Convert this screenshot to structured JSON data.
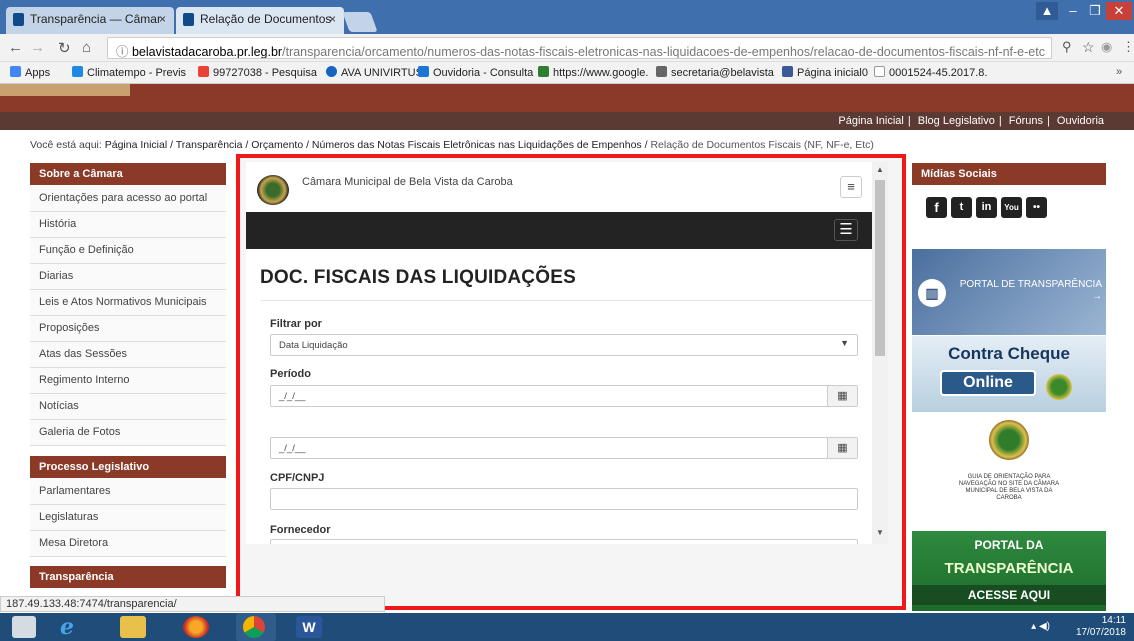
{
  "browser": {
    "tabs": [
      {
        "label": "Transparência — Câmar",
        "close": "×"
      },
      {
        "label": "Relação de Documentos",
        "close": "×"
      }
    ],
    "url_host": "belavistadacaroba.pr.leg.br",
    "url_path": "/transparencia/orcamento/numeros-das-notas-fiscais-eletronicas-nas-liquidacoes-de-empenhos/relacao-de-documentos-fiscais-nf-nf-e-etc",
    "bookmarks": [
      {
        "label": "Apps",
        "color": "#4285f4"
      },
      {
        "label": "Climatempo - Previs",
        "color": "#1e88e5"
      },
      {
        "label": "99727038 - Pesquisa",
        "color": "#ea4335"
      },
      {
        "label": "AVA UNIVIRTUS",
        "color": "#1565c0"
      },
      {
        "label": "Ouvidoria - Consulta",
        "color": "#1976d2"
      },
      {
        "label": "https://www.google.",
        "color": "#2e7d32"
      },
      {
        "label": "secretaria@belavista",
        "color": "#666666"
      },
      {
        "label": "Página inicial0",
        "color": "#3b5998"
      },
      {
        "label": "0001524-45.2017.8.",
        "color": "#9e9e9e"
      }
    ],
    "status_url": "187.49.133.48:7474/transparencia/"
  },
  "site": {
    "topnav": [
      "Página Inicial",
      "Blog Legislativo",
      "Fóruns",
      "Ouvidoria"
    ],
    "breadcrumb_prefix": "Você está aqui:",
    "breadcrumb_links": "Página Inicial / Transparência / Orçamento / Números das Notas Fiscais Eletrônicas nas Liquidações de Empenhos /",
    "breadcrumb_current": "Relação de Documentos Fiscais (NF, NF-e, Etc)",
    "sidebar": {
      "section1_title": "Sobre a Câmara",
      "section1_items": [
        "Orientações para acesso ao portal",
        "História",
        "Função e Definição",
        "Diarias",
        "Leis e Atos Normativos Municipais",
        "Proposições",
        "Atas das Sessões",
        "Regimento Interno",
        "Notícias",
        "Galeria de Fotos"
      ],
      "section2_title": "Processo Legislativo",
      "section2_items": [
        "Parlamentares",
        "Legislaturas",
        "Mesa Diretora"
      ],
      "section3_title": "Transparência"
    },
    "right": {
      "social_title": "Mídias Sociais",
      "social_icons": [
        "f",
        "t",
        "in",
        "You",
        "••"
      ],
      "banner1": "PORTAL DE TRANSPARÊNCIA →",
      "banner2_line1": "Contra Cheque",
      "banner2_line2": "Online",
      "banner3": "GUIA DE ORIENTAÇÃO PARA NAVEGAÇÃO NO SITE DA CÂMARA MUNICIPAL DE BELA VISTA DA CAROBA",
      "banner4_line1": "PORTAL DA",
      "banner4_line2": "TRANSPARÊNCIA",
      "banner4_line3": "ACESSE AQUI"
    }
  },
  "frame": {
    "org_name": "Câmara Municipal de Bela Vista da Caroba",
    "title": "DOC. FISCAIS DAS LIQUIDAÇÕES",
    "filter_label": "Filtrar por",
    "filter_value": "Data Liquidação",
    "period_label": "Período",
    "date_placeholder1": "_/_/__",
    "date_placeholder2": "_/_/__",
    "cpf_label": "CPF/CNPJ",
    "supplier_label": "Fornecedor"
  },
  "taskbar": {
    "time": "14:11",
    "date": "17/07/2018"
  }
}
